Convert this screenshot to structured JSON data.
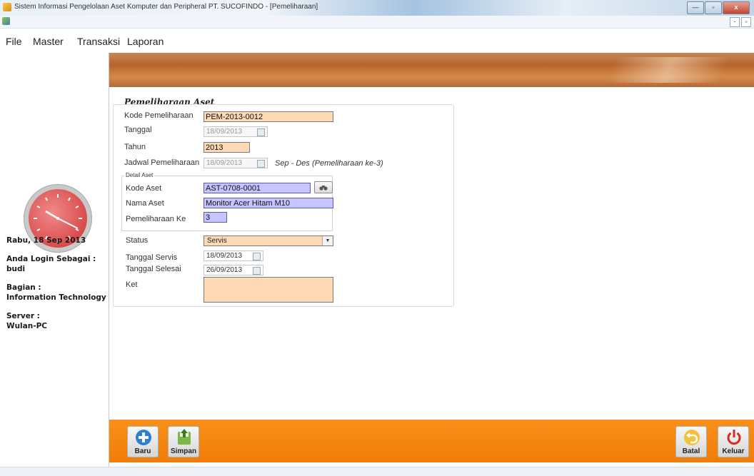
{
  "window": {
    "title": "Sistem Informasi Pengelolaan Aset Komputer dan Peripheral PT. SUCOFINDO - [Pemeliharaan]",
    "minimize": "—",
    "maximize": "▫",
    "close": "x",
    "child_minimize": "-",
    "child_restore": "▫"
  },
  "menu": {
    "file": "File",
    "master": "Master",
    "transaksi": "Transaksi",
    "laporan": "Laporan"
  },
  "sidebar": {
    "date": "Rabu, 18 Sep 2013",
    "login_label": "Anda Login Sebagai :",
    "login_user": "budi",
    "bagian_label": "Bagian :",
    "bagian_value": "Information Technology",
    "server_label": "Server :",
    "server_value": "Wulan-PC"
  },
  "form": {
    "title": "Pemeliharaan Aset",
    "kode_label": "Kode Pemeliharaan",
    "kode_value": "PEM-2013-0012",
    "tanggal_label": "Tanggal",
    "tanggal_value": "18/09/2013",
    "tahun_label": "Tahun",
    "tahun_value": "2013",
    "jadwal_label": "Jadwal Pemeliharaan",
    "jadwal_value": "18/09/2013",
    "jadwal_note": "Sep - Des (Pemeliharaan ke-3)",
    "detail_title": "Detail Aset",
    "kode_aset_label": "Kode Aset",
    "kode_aset_value": "AST-0708-0001",
    "nama_aset_label": "Nama Aset",
    "nama_aset_value": "Monitor Acer Hitam M10",
    "pemeliharaan_ke_label": "Pemeliharaan Ke",
    "pemeliharaan_ke_value": "3",
    "status_label": "Status",
    "status_value": "Servis",
    "tgl_servis_label": "Tanggal Servis",
    "tgl_servis_value": "18/09/2013",
    "tgl_selesai_label": "Tanggal Selesai",
    "tgl_selesai_value": "26/09/2013",
    "ket_label": "Ket",
    "ket_value": ""
  },
  "toolbar": {
    "baru": "Baru",
    "simpan": "Simpan",
    "batal": "Batal",
    "keluar": "Keluar"
  },
  "colors": {
    "input_fill": "#fdd9b5",
    "detail_fill": "#c7c5ff",
    "toolbar": "#f58512",
    "clock_face": "#e06060"
  }
}
